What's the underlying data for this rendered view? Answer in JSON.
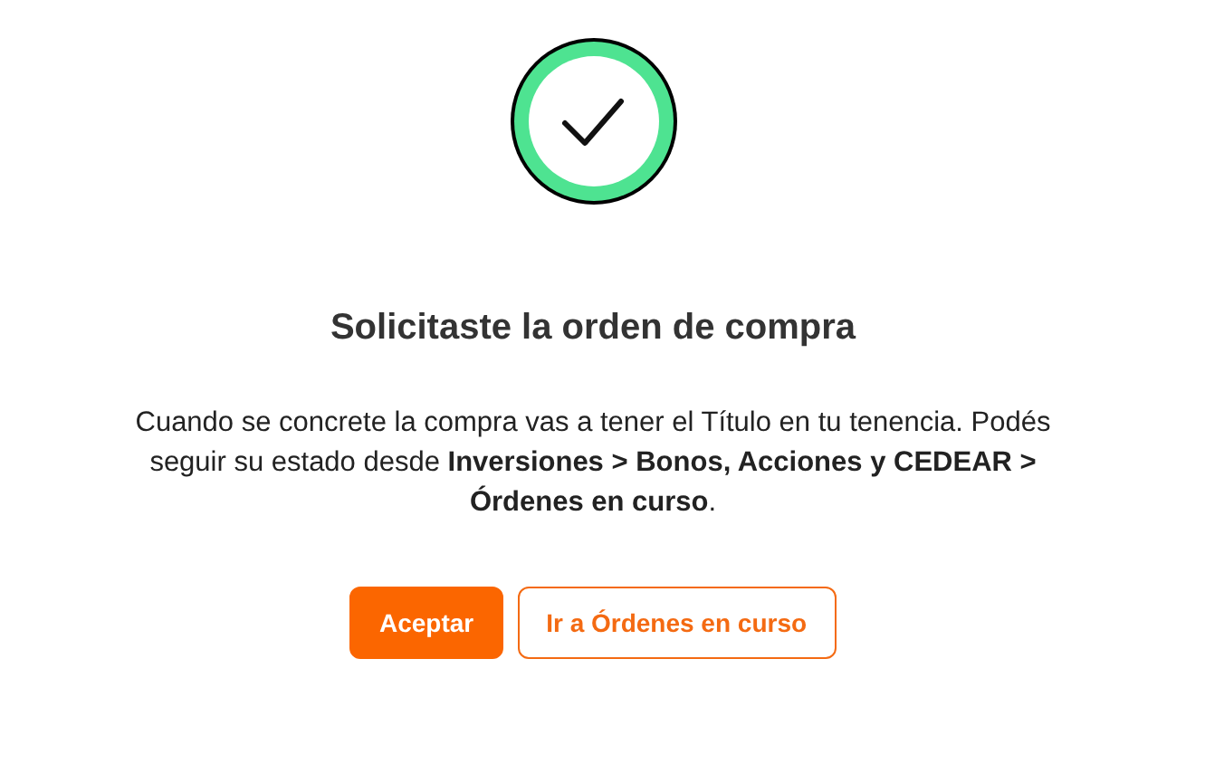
{
  "title": "Solicitaste la orden de compra",
  "message": "Cuando se concrete la compra vas a tener el Título en tu tenencia. Podés seguir su estado desde **Inversiones > Bonos, Acciones y CEDEAR > Órdenes en curso**.",
  "buttons": [
    {
      "label": "Aceptar",
      "kind": "primary"
    },
    {
      "label": "Ir a Órdenes en curso",
      "kind": "secondary"
    }
  ]
}
